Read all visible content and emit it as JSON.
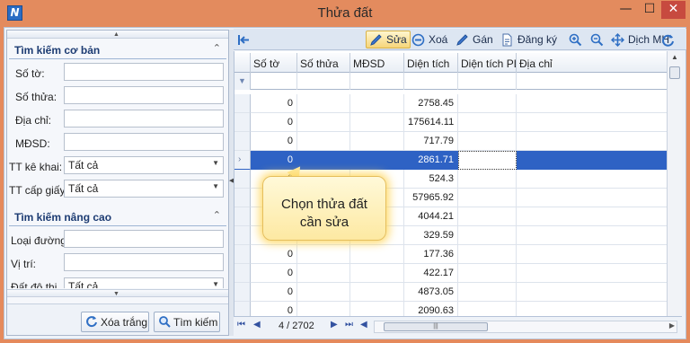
{
  "window": {
    "title": "Thửa đất",
    "app_icon_letter": "N",
    "buttons": {
      "minimize": "—",
      "maximize": "☐",
      "close": "✕"
    }
  },
  "left_panel": {
    "basic": {
      "title": "Tìm kiếm cơ bản",
      "fields": [
        {
          "label": "Số tờ:",
          "value": ""
        },
        {
          "label": "Số thửa:",
          "value": ""
        },
        {
          "label": "Địa chỉ:",
          "value": ""
        },
        {
          "label": "MĐSD:",
          "value": ""
        }
      ],
      "dropdowns": [
        {
          "label": "TT kê khai:",
          "value": "Tất cả"
        },
        {
          "label": "TT cấp giấy:",
          "value": "Tất cả"
        }
      ]
    },
    "advanced": {
      "title": "Tìm kiếm nâng cao",
      "fields": [
        {
          "label": "Loại đường",
          "value": ""
        },
        {
          "label": "Vị trí:",
          "value": ""
        }
      ],
      "dropdown": {
        "label": "Đất đô thị",
        "value": "Tất cả"
      }
    },
    "buttons": {
      "clear": "Xóa trắng",
      "search": "Tìm kiếm"
    }
  },
  "toolbar": {
    "edit": "Sửa",
    "delete": "Xoá",
    "assign": "Gán",
    "register": "Đăng ký",
    "view": "Dịch MH"
  },
  "grid": {
    "columns": [
      "Số tờ",
      "Số thửa",
      "MĐSD",
      "Diện tích",
      "Diện tích PL",
      "Địa chỉ"
    ],
    "rows": [
      {
        "so_to": "",
        "dien_tich": ""
      },
      {
        "so_to": "0",
        "dien_tich": "2758.45"
      },
      {
        "so_to": "0",
        "dien_tich": "175614.11"
      },
      {
        "so_to": "0",
        "dien_tich": "717.79"
      },
      {
        "so_to": "0",
        "dien_tich": "2861.71"
      },
      {
        "so_to": "0",
        "dien_tich": "524.3"
      },
      {
        "so_to": "0",
        "dien_tich": "57965.92"
      },
      {
        "so_to": "0",
        "dien_tich": "4044.21"
      },
      {
        "so_to": "0",
        "dien_tich": "329.59"
      },
      {
        "so_to": "0",
        "dien_tich": "177.36"
      },
      {
        "so_to": "0",
        "dien_tich": "422.17"
      },
      {
        "so_to": "0",
        "dien_tich": "4873.05"
      },
      {
        "so_to": "0",
        "dien_tich": "2090.63"
      }
    ],
    "selected_row": 4,
    "selected_indicator": "›"
  },
  "navigator": {
    "position": "4 / 2702"
  },
  "callout": {
    "text": "Chọn thửa đất cần sửa"
  }
}
